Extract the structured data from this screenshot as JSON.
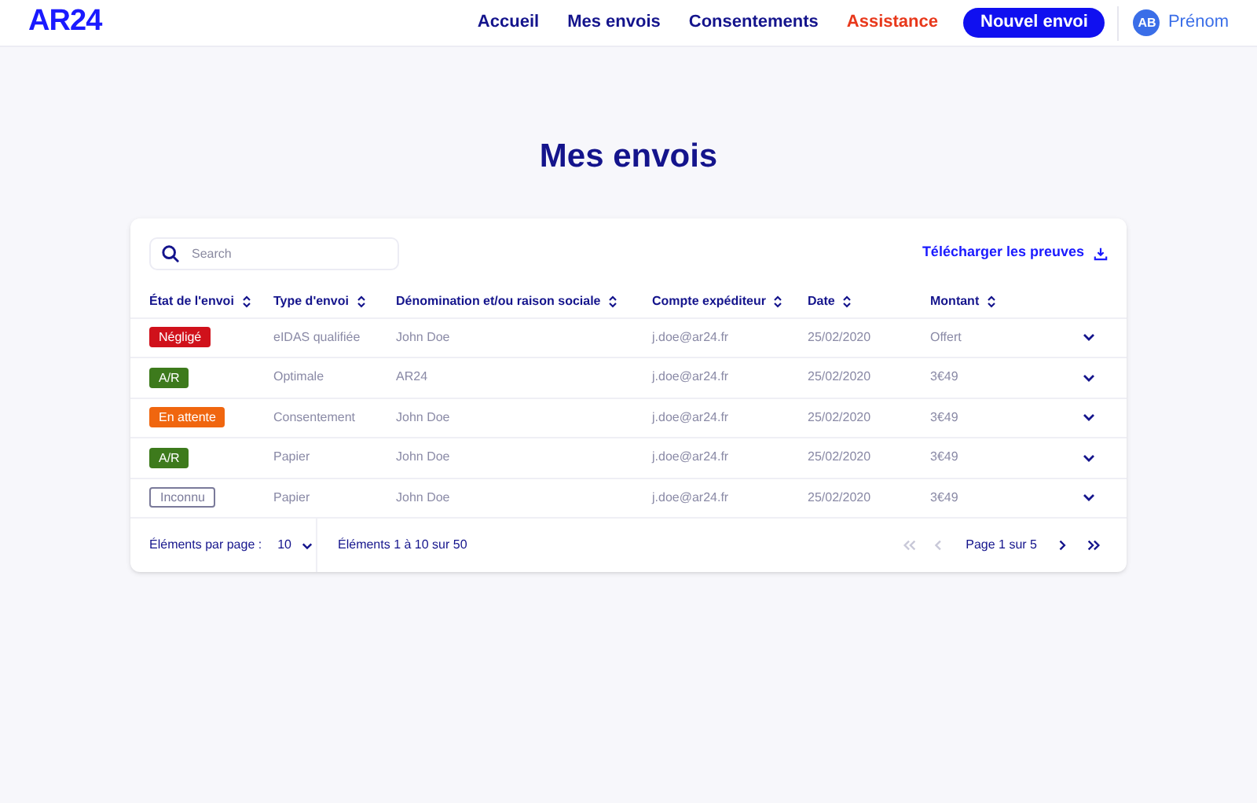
{
  "header": {
    "logo": "AR24",
    "nav": [
      {
        "label": "Accueil",
        "color": "#14148c"
      },
      {
        "label": "Mes envois",
        "color": "#14148c"
      },
      {
        "label": "Consentements",
        "color": "#14148c"
      },
      {
        "label": "Assistance",
        "color": "#e8381b"
      }
    ],
    "cta": "Nouvel envoi",
    "user": {
      "initials": "AB",
      "name": "Prénom"
    }
  },
  "title": "Mes envois",
  "search": {
    "placeholder": "Search"
  },
  "download": "Télécharger les preuves",
  "table": {
    "columns": [
      "État de l'envoi",
      "Type d'envoi",
      "Dénomination et/ou raison sociale",
      "Compte expéditeur",
      "Date",
      "Montant"
    ],
    "rows": [
      {
        "status": {
          "label": "Négligé",
          "kind": "filled",
          "color": "#d0111b"
        },
        "type": "eIDAS qualifiée",
        "name": "John Doe",
        "account": "j.doe@ar24.fr",
        "date": "25/02/2020",
        "amount": "Offert"
      },
      {
        "status": {
          "label": "A/R",
          "kind": "filled",
          "color": "#3d7a1c"
        },
        "type": "Optimale",
        "name": "AR24",
        "account": "j.doe@ar24.fr",
        "date": "25/02/2020",
        "amount": "3€49"
      },
      {
        "status": {
          "label": "En attente",
          "kind": "filled",
          "color": "#f0660f"
        },
        "type": "Consentement",
        "name": "John Doe",
        "account": "j.doe@ar24.fr",
        "date": "25/02/2020",
        "amount": "3€49"
      },
      {
        "status": {
          "label": "A/R",
          "kind": "filled",
          "color": "#3d7a1c"
        },
        "type": "Papier",
        "name": "John Doe",
        "account": "j.doe@ar24.fr",
        "date": "25/02/2020",
        "amount": "3€49"
      },
      {
        "status": {
          "label": "Inconnu",
          "kind": "outline",
          "color": "#7a7a9a"
        },
        "type": "Papier",
        "name": "John Doe",
        "account": "j.doe@ar24.fr",
        "date": "25/02/2020",
        "amount": "3€49"
      }
    ]
  },
  "footer": {
    "per_page_label": "Éléments par page :",
    "per_page": "10",
    "range": "Éléments 1 à 10 sur 50",
    "page": "Page 1 sur 5",
    "buttons": [
      {
        "kind": "first",
        "disabled": true
      },
      {
        "kind": "prev",
        "disabled": true
      },
      {
        "kind": "next",
        "disabled": false
      },
      {
        "kind": "last",
        "disabled": false
      }
    ]
  }
}
